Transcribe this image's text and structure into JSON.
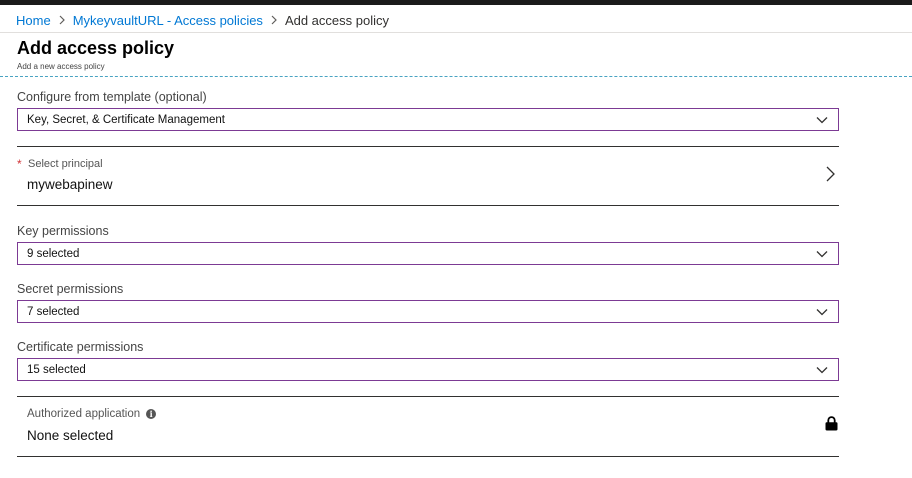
{
  "breadcrumb": {
    "home": "Home",
    "parent": "MykeyvaultURL - Access policies",
    "current": "Add access policy"
  },
  "header": {
    "title": "Add access policy",
    "subtitle": "Add a new access policy"
  },
  "form": {
    "template": {
      "label": "Configure from template (optional)",
      "value": "Key, Secret, & Certificate Management"
    },
    "principal": {
      "required_marker": "*",
      "label": "Select principal",
      "value": "mywebapinew"
    },
    "key_permissions": {
      "label": "Key permissions",
      "value": "9 selected"
    },
    "secret_permissions": {
      "label": "Secret permissions",
      "value": "7 selected"
    },
    "certificate_permissions": {
      "label": "Certificate permissions",
      "value": "15 selected"
    },
    "authorized_application": {
      "label": "Authorized application",
      "info_glyph": "i",
      "value": "None selected"
    }
  },
  "icons": {
    "breadcrumb_separator": "chevron-right-icon",
    "dropdown": "chevron-down-icon",
    "principal": "chevron-right-icon",
    "info": "info-icon",
    "lock": "lock-icon"
  },
  "colors": {
    "link": "#0078d4",
    "dropdown_border": "#7c3a94",
    "required": "#d13438",
    "title_divider": "#48a3c2"
  }
}
